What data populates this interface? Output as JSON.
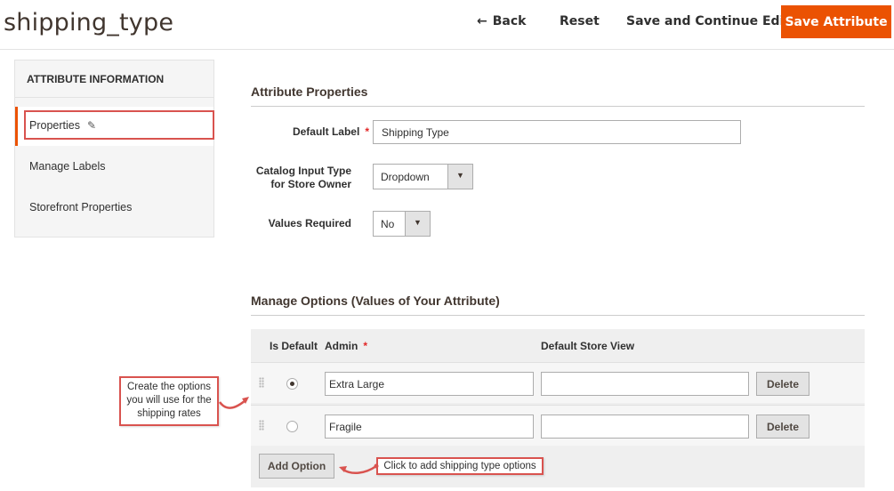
{
  "header": {
    "title": "shipping_type",
    "back_label": "Back",
    "reset_label": "Reset",
    "save_continue_label": "Save and Continue Edit",
    "save_label": "Save Attribute"
  },
  "sidebar": {
    "heading": "ATTRIBUTE INFORMATION",
    "items": [
      {
        "label": "Properties",
        "active": true
      },
      {
        "label": "Manage Labels"
      },
      {
        "label": "Storefront Properties"
      }
    ]
  },
  "properties": {
    "section_title": "Attribute Properties",
    "default_label": {
      "label": "Default Label",
      "value": "Shipping Type"
    },
    "input_type": {
      "label_line1": "Catalog Input Type",
      "label_line2": "for Store Owner",
      "value": "Dropdown"
    },
    "values_required": {
      "label": "Values Required",
      "value": "No"
    }
  },
  "options": {
    "section_title": "Manage Options (Values of Your Attribute)",
    "col_default": "Is Default",
    "col_admin": "Admin",
    "col_store": "Default Store View",
    "rows": [
      {
        "admin": "Extra Large",
        "store": "",
        "default": true,
        "delete_label": "Delete"
      },
      {
        "admin": "Fragile",
        "store": "",
        "default": false,
        "delete_label": "Delete"
      }
    ],
    "add_label": "Add Option"
  },
  "callouts": {
    "create_line1": "Create the options",
    "create_line2": "you will use for the",
    "create_line3": "shipping rates",
    "add_hint": "Click to add shipping type options"
  },
  "colors": {
    "accent": "#eb5202",
    "callout_border": "#d9534f"
  }
}
